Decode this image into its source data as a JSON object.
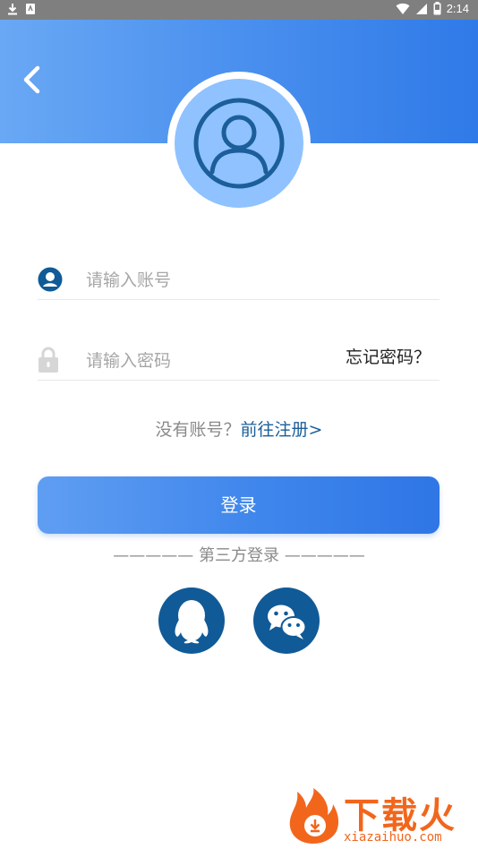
{
  "status_bar": {
    "time": "2:14",
    "icons": [
      "download-icon",
      "sim-card-icon",
      "wifi-icon",
      "cell-signal-icon",
      "battery-icon"
    ]
  },
  "header": {
    "back_icon": "chevron-left-icon",
    "gradient": [
      "#69a8f4",
      "#2f7ae8"
    ]
  },
  "avatar": {
    "icon": "user-avatar-icon",
    "fill": "#8fc2ff",
    "stroke": "#1b5e9a"
  },
  "form": {
    "account_placeholder": "请输入账号",
    "account_icon": "user-circle-icon",
    "password_placeholder": "请输入密码",
    "password_icon": "lock-icon",
    "forgot_password": "忘记密码？"
  },
  "register": {
    "prompt": "没有账号？",
    "link": "前往注册>"
  },
  "login_button": "登录",
  "third_party": {
    "label": "————— 第三方登录 —————",
    "options": [
      {
        "name": "qq",
        "icon": "qq-penguin-icon"
      },
      {
        "name": "wechat",
        "icon": "wechat-icon"
      }
    ],
    "color": "#105a97"
  },
  "watermark": {
    "text": "下载火",
    "url": "xiazaihuo.com"
  }
}
